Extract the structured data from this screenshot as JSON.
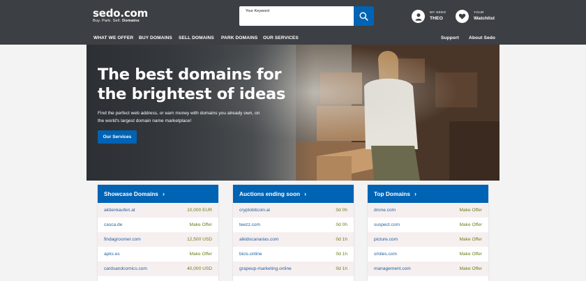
{
  "header": {
    "logo": "sedo.com",
    "tagline_prefix": "Buy. Park. Sell.",
    "tagline_bold": "Domains",
    "search_placeholder": "Your Keyword",
    "user_small": "MY SEDO",
    "user_name": "THEO",
    "watch_small": "YOUR",
    "watch_label": "Watchlist"
  },
  "nav": {
    "items": [
      "WHAT WE OFFER",
      "BUY DOMAINS",
      "SELL DOMAINS",
      "PARK DOMAINS",
      "OUR SERVICES"
    ],
    "right": [
      "Support",
      "About Sedo"
    ]
  },
  "hero": {
    "title_line1": "The best domains for",
    "title_line2": "the brightest of ideas",
    "subtitle": "Find the perfect web address, or earn money with domains you already own, on the world's largest domain name marketplace!",
    "button": "Our Services"
  },
  "panels": [
    {
      "title": "Showcase Domains",
      "rows": [
        {
          "domain": "aktienkaufen.at",
          "value": "10,000 EUR"
        },
        {
          "domain": "casca.de",
          "value": "Make Offer"
        },
        {
          "domain": "findagroomer.com",
          "value": "12,500 USD"
        },
        {
          "domain": "apks.es",
          "value": "Make Offer"
        },
        {
          "domain": "cardsandcomics.com",
          "value": "40,000 USD"
        }
      ]
    },
    {
      "title": "Auctions ending soon",
      "rows": [
        {
          "domain": "cryptobitcoin.ai",
          "value": "0d 0h"
        },
        {
          "domain": "teezz.com",
          "value": "0d 0h"
        },
        {
          "domain": "aikidocanarias.com",
          "value": "0d 1h"
        },
        {
          "domain": "bicis.online",
          "value": "0d 1h"
        },
        {
          "domain": "grapeup-marketing.online",
          "value": "0d 1h"
        }
      ]
    },
    {
      "title": "Top Domains",
      "rows": [
        {
          "domain": "drone.com",
          "value": "Make Offer"
        },
        {
          "domain": "suspect.com",
          "value": "Make Offer"
        },
        {
          "domain": "picture.com",
          "value": "Make Offer"
        },
        {
          "domain": "smiles.com",
          "value": "Make Offer"
        },
        {
          "domain": "management.com",
          "value": "Make Offer"
        }
      ]
    }
  ],
  "colors": {
    "header_bg": "#3c3f43",
    "accent_blue": "#0063b4",
    "domain_link": "#1f5f9f",
    "value_green": "#6a7d1a",
    "alt_row": "#f6efef"
  },
  "icons": {
    "search": "search-icon",
    "user": "user-icon",
    "watchlist": "heart-icon",
    "chevron": "chevron-right-icon"
  }
}
